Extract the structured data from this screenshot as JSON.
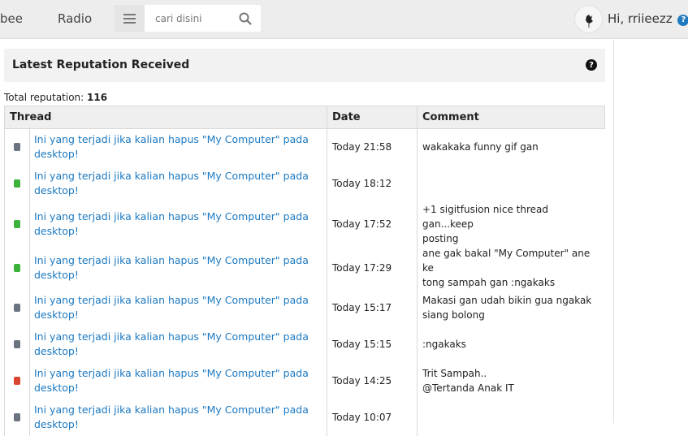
{
  "nav": {
    "partial_item": "bee",
    "radio": "Radio",
    "search_placeholder": "cari disini",
    "greeting": "Hi, rriieezz",
    "help_icon": "question-icon"
  },
  "panel": {
    "title": "Latest Reputation Received",
    "help_glyph": "?"
  },
  "total": {
    "label": "Total reputation:",
    "value": "116"
  },
  "table": {
    "headers": [
      "Thread",
      "Date",
      "Comment"
    ],
    "rows": [
      {
        "color": "#6b7280",
        "thread_line1": "Ini yang terjadi jika kalian hapus \"My Computer\" pada",
        "thread_line2": "desktop!",
        "date": "Today 21:58",
        "comment_line1": "wakakaka funny gif gan",
        "comment_line2": ""
      },
      {
        "color": "#3cb23c",
        "thread_line1": "Ini yang terjadi jika kalian hapus \"My Computer\" pada",
        "thread_line2": "desktop!",
        "date": "Today 18:12",
        "comment_line1": "",
        "comment_line2": ""
      },
      {
        "color": "#3cb23c",
        "thread_line1": "Ini yang terjadi jika kalian hapus \"My Computer\" pada",
        "thread_line2": "desktop!",
        "date": "Today 17:52",
        "comment_line1": "+1 sigitfusion nice thread gan...keep",
        "comment_line2": "posting"
      },
      {
        "color": "#3cb23c",
        "thread_line1": "Ini yang terjadi jika kalian hapus \"My Computer\" pada",
        "thread_line2": "desktop!",
        "date": "Today 17:29",
        "comment_line1": "ane gak bakal \"My Computer\" ane ke",
        "comment_line2": "tong sampah gan :ngakaks"
      },
      {
        "color": "#6b7280",
        "thread_line1": "Ini yang terjadi jika kalian hapus \"My Computer\" pada",
        "thread_line2": "desktop!",
        "date": "Today 15:17",
        "comment_line1": "Makasi gan udah bikin gua ngakak",
        "comment_line2": "siang bolong"
      },
      {
        "color": "#6b7280",
        "thread_line1": "Ini yang terjadi jika kalian hapus \"My Computer\" pada",
        "thread_line2": "desktop!",
        "date": "Today 15:15",
        "comment_line1": ":ngakaks",
        "comment_line2": ""
      },
      {
        "color": "#d9452f",
        "thread_line1": "Ini yang terjadi jika kalian hapus \"My Computer\" pada",
        "thread_line2": "desktop!",
        "date": "Today 14:25",
        "comment_line1": "Trit Sampah..",
        "comment_line2": "@Tertanda Anak IT"
      },
      {
        "color": "#6b7280",
        "thread_line1": "Ini yang terjadi jika kalian hapus \"My Computer\" pada",
        "thread_line2": "desktop!",
        "date": "Today 10:07",
        "comment_line1": "",
        "comment_line2": ""
      }
    ]
  }
}
